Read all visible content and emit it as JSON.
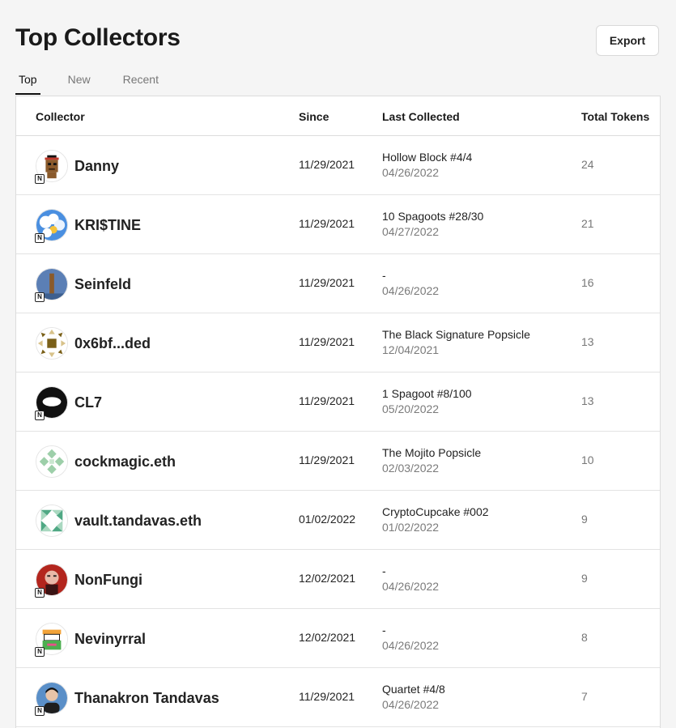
{
  "header": {
    "title": "Top Collectors",
    "export_label": "Export"
  },
  "tabs": [
    {
      "label": "Top",
      "active": true
    },
    {
      "label": "New",
      "active": false
    },
    {
      "label": "Recent",
      "active": false
    }
  ],
  "table": {
    "columns": {
      "collector": "Collector",
      "since": "Since",
      "last_collected": "Last Collected",
      "total_tokens": "Total Tokens"
    },
    "badge_label": "N",
    "rows": [
      {
        "name": "Danny",
        "since": "11/29/2021",
        "last_title": "Hollow Block #4/4",
        "last_date": "04/26/2022",
        "total": "24",
        "avatar_icon": "pixel-punk-avatar-icon",
        "badge": true
      },
      {
        "name": "KRI$TINE",
        "since": "11/29/2021",
        "last_title": "10 Spagoots #28/30",
        "last_date": "04/27/2022",
        "total": "21",
        "avatar_icon": "sky-clouds-avatar-icon",
        "badge": true
      },
      {
        "name": "Seinfeld",
        "since": "11/29/2021",
        "last_title": "-",
        "last_date": "04/26/2022",
        "total": "16",
        "avatar_icon": "monolith-avatar-icon",
        "badge": true
      },
      {
        "name": "0x6bf...ded",
        "since": "11/29/2021",
        "last_title": "The Black Signature Popsicle",
        "last_date": "12/04/2021",
        "total": "13",
        "avatar_icon": "identicon-brown-avatar-icon",
        "badge": false
      },
      {
        "name": "CL7",
        "since": "11/29/2021",
        "last_title": "1 Spagoot #8/100",
        "last_date": "05/20/2022",
        "total": "13",
        "avatar_icon": "black-ring-avatar-icon",
        "badge": true
      },
      {
        "name": "cockmagic.eth",
        "since": "11/29/2021",
        "last_title": "The Mojito Popsicle",
        "last_date": "02/03/2022",
        "total": "10",
        "avatar_icon": "identicon-green-avatar-icon",
        "badge": false
      },
      {
        "name": "vault.tandavas.eth",
        "since": "01/02/2022",
        "last_title": "CryptoCupcake #002",
        "last_date": "01/02/2022",
        "total": "9",
        "avatar_icon": "identicon-teal-avatar-icon",
        "badge": false
      },
      {
        "name": "NonFungi",
        "since": "12/02/2021",
        "last_title": "-",
        "last_date": "04/26/2022",
        "total": "9",
        "avatar_icon": "red-portrait-avatar-icon",
        "badge": true
      },
      {
        "name": "Nevinyrral",
        "since": "12/02/2021",
        "last_title": "-",
        "last_date": "04/26/2022",
        "total": "8",
        "avatar_icon": "pixel-frog-avatar-icon",
        "badge": true
      },
      {
        "name": "Thanakron Tandavas",
        "since": "11/29/2021",
        "last_title": "Quartet #4/8",
        "last_date": "04/26/2022",
        "total": "7",
        "avatar_icon": "person-photo-avatar-icon",
        "badge": true
      }
    ]
  }
}
